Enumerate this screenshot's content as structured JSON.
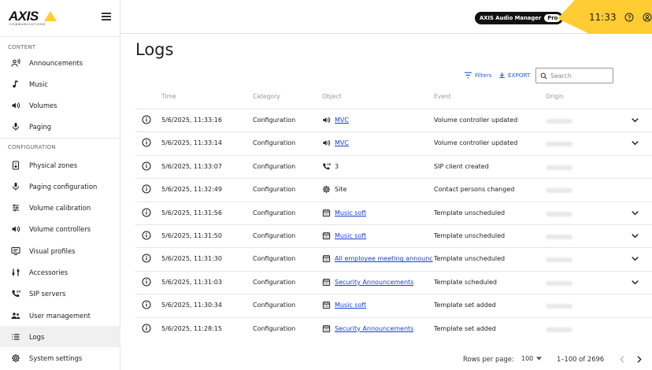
{
  "brand": {
    "logo_text": "AXIS",
    "logo_sub": "COMMUNICATIONS"
  },
  "sidebar": {
    "content_section": "CONTENT",
    "configuration_section": "CONFIGURATION",
    "content_items": [
      {
        "label": "Announcements",
        "icon": "announcement-icon"
      },
      {
        "label": "Music",
        "icon": "music-note-icon"
      },
      {
        "label": "Volumes",
        "icon": "speaker-icon"
      },
      {
        "label": "Paging",
        "icon": "microphone-icon"
      }
    ],
    "config_items": [
      {
        "label": "Physical zones",
        "icon": "speaker-device-icon"
      },
      {
        "label": "Paging configuration",
        "icon": "microphone-icon"
      },
      {
        "label": "Volume calibration",
        "icon": "sliders-icon"
      },
      {
        "label": "Volume controllers",
        "icon": "speaker-icon"
      },
      {
        "label": "Visual profiles",
        "icon": "display-icon"
      },
      {
        "label": "Accessories",
        "icon": "accessories-icon"
      },
      {
        "label": "SIP servers",
        "icon": "sip-phone-icon"
      },
      {
        "label": "User management",
        "icon": "users-icon"
      },
      {
        "label": "Logs",
        "icon": "list-icon",
        "active": true
      },
      {
        "label": "System settings",
        "icon": "gear-icon"
      }
    ]
  },
  "topbar": {
    "product": "AXIS Audio Manager",
    "edition": "Pro",
    "time": "11:33"
  },
  "main": {
    "title": "Logs",
    "filters_label": "Filters",
    "export_label": "EXPORT",
    "search_placeholder": "Search",
    "columns": [
      "Time",
      "Category",
      "Object",
      "Event",
      "Origin"
    ],
    "rows": [
      {
        "time": "5/6/2025, 11:33:16",
        "category": "Configuration",
        "object": "MVC",
        "object_icon": "speaker-icon",
        "link": true,
        "event": "Volume controller updated",
        "expandable": true
      },
      {
        "time": "5/6/2025, 11:33:14",
        "category": "Configuration",
        "object": "MVC",
        "object_icon": "speaker-icon",
        "link": true,
        "event": "Volume controller updated",
        "expandable": true
      },
      {
        "time": "5/6/2025, 11:33:07",
        "category": "Configuration",
        "object": "3",
        "object_icon": "sip-phone-icon",
        "link": false,
        "event": "SIP client created",
        "expandable": false
      },
      {
        "time": "5/6/2025, 11:32:49",
        "category": "Configuration",
        "object": "Site",
        "object_icon": "gear-icon",
        "link": false,
        "event": "Contact persons changed",
        "expandable": false
      },
      {
        "time": "5/6/2025, 11:31:56",
        "category": "Configuration",
        "object": "Music soft",
        "object_icon": "calendar-icon",
        "link": true,
        "event": "Template unscheduled",
        "expandable": true
      },
      {
        "time": "5/6/2025, 11:31:50",
        "category": "Configuration",
        "object": "Music soft",
        "object_icon": "calendar-icon",
        "link": true,
        "event": "Template unscheduled",
        "expandable": true
      },
      {
        "time": "5/6/2025, 11:31:30",
        "category": "Configuration",
        "object": "All employee meeting announc",
        "object_icon": "calendar-icon",
        "link": true,
        "event": "Template unscheduled",
        "expandable": true
      },
      {
        "time": "5/6/2025, 11:31:03",
        "category": "Configuration",
        "object": "Security Announcements",
        "object_icon": "calendar-icon",
        "link": true,
        "event": "Template scheduled",
        "expandable": true
      },
      {
        "time": "5/6/2025, 11:30:34",
        "category": "Configuration",
        "object": "Music soft",
        "object_icon": "calendar-icon",
        "link": true,
        "event": "Template set added",
        "expandable": false
      },
      {
        "time": "5/6/2025, 11:28:15",
        "category": "Configuration",
        "object": "Security Announcements",
        "object_icon": "calendar-icon",
        "link": true,
        "event": "Template set added",
        "expandable": false
      }
    ]
  },
  "footer": {
    "rows_per_page_label": "Rows per page:",
    "rows_per_page_value": "100",
    "range": "1–100 of 2696"
  },
  "colors": {
    "accent_yellow": "#ffcc33",
    "link_blue": "#1a3fd6",
    "action_blue": "#1a5fcc"
  }
}
